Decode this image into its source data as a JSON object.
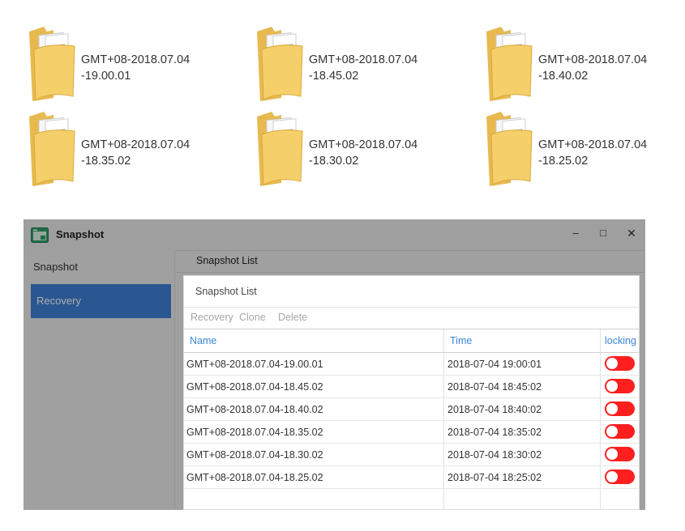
{
  "desktop": {
    "folders": [
      {
        "line1": "GMT+08-2018.07.04",
        "line2": "-19.00.01"
      },
      {
        "line1": "GMT+08-2018.07.04",
        "line2": "-18.45.02"
      },
      {
        "line1": "GMT+08-2018.07.04",
        "line2": "-18.40.02"
      },
      {
        "line1": "GMT+08-2018.07.04",
        "line2": "-18.35.02"
      },
      {
        "line1": "GMT+08-2018.07.04",
        "line2": "-18.30.02"
      },
      {
        "line1": "GMT+08-2018.07.04",
        "line2": "-18.25.02"
      }
    ]
  },
  "window": {
    "title": "Snapshot",
    "controls": {
      "minimize": "–",
      "maximize": "□",
      "close": "✕"
    },
    "sidebar": {
      "items": [
        {
          "label": "Snapshot"
        },
        {
          "label": "Recovery"
        }
      ]
    },
    "tab_title": "Snapshot List",
    "panel": {
      "title": "Snapshot List",
      "toolbar": {
        "recovery": "Recovery",
        "clone": "Clone",
        "delete": "Delete"
      },
      "columns": {
        "name": "Name",
        "time": "Time",
        "locking": "locking"
      },
      "rows": [
        {
          "name": "GMT+08-2018.07.04-19.00.01",
          "time": "2018-07-04 19:00:01"
        },
        {
          "name": "GMT+08-2018.07.04-18.45.02",
          "time": "2018-07-04 18:45:02"
        },
        {
          "name": "GMT+08-2018.07.04-18.40.02",
          "time": "2018-07-04 18:40:02"
        },
        {
          "name": "GMT+08-2018.07.04-18.35.02",
          "time": "2018-07-04 18:35:02"
        },
        {
          "name": "GMT+08-2018.07.04-18.30.02",
          "time": "2018-07-04 18:30:02"
        },
        {
          "name": "GMT+08-2018.07.04-18.25.02",
          "time": "2018-07-04 18:25:02"
        }
      ]
    },
    "colors": {
      "accent": "#3f7fd6",
      "toggle": "#ff1f1f",
      "header_text": "#3b86d6"
    },
    "icons": {
      "app": "app-window-icon",
      "folder": "folder-icon"
    }
  }
}
